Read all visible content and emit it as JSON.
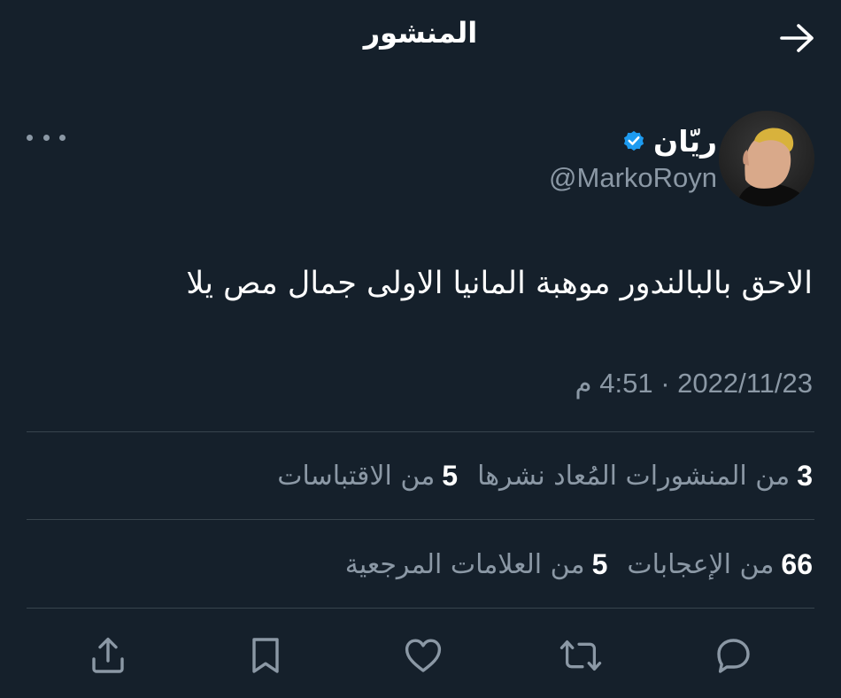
{
  "header": {
    "title": "المنشور",
    "back_icon": "arrow-right-icon"
  },
  "author": {
    "name": "ريّان",
    "handle": "@MarkoRoyn",
    "verified": true,
    "verified_color": "#1d9bf0"
  },
  "tweet": {
    "text": "الاحق بالبالندور موهبة المانيا الاولى جمال مص يلا",
    "timestamp": "2022/11/23 · 4:51 م"
  },
  "stats": {
    "retweets_count": "3",
    "retweets_label": "من المنشورات المُعاد نشرها",
    "quotes_count": "5",
    "quotes_label": "من الاقتباسات",
    "likes_count": "66",
    "likes_label": "من الإعجابات",
    "bookmarks_count": "5",
    "bookmarks_label": "من العلامات المرجعية"
  },
  "actions": [
    "reply-icon",
    "retweet-icon",
    "like-icon",
    "bookmark-icon",
    "share-icon"
  ],
  "colors": {
    "background": "#15202b",
    "secondary_text": "#8b98a5",
    "divider": "#38444d",
    "accent": "#1d9bf0"
  }
}
